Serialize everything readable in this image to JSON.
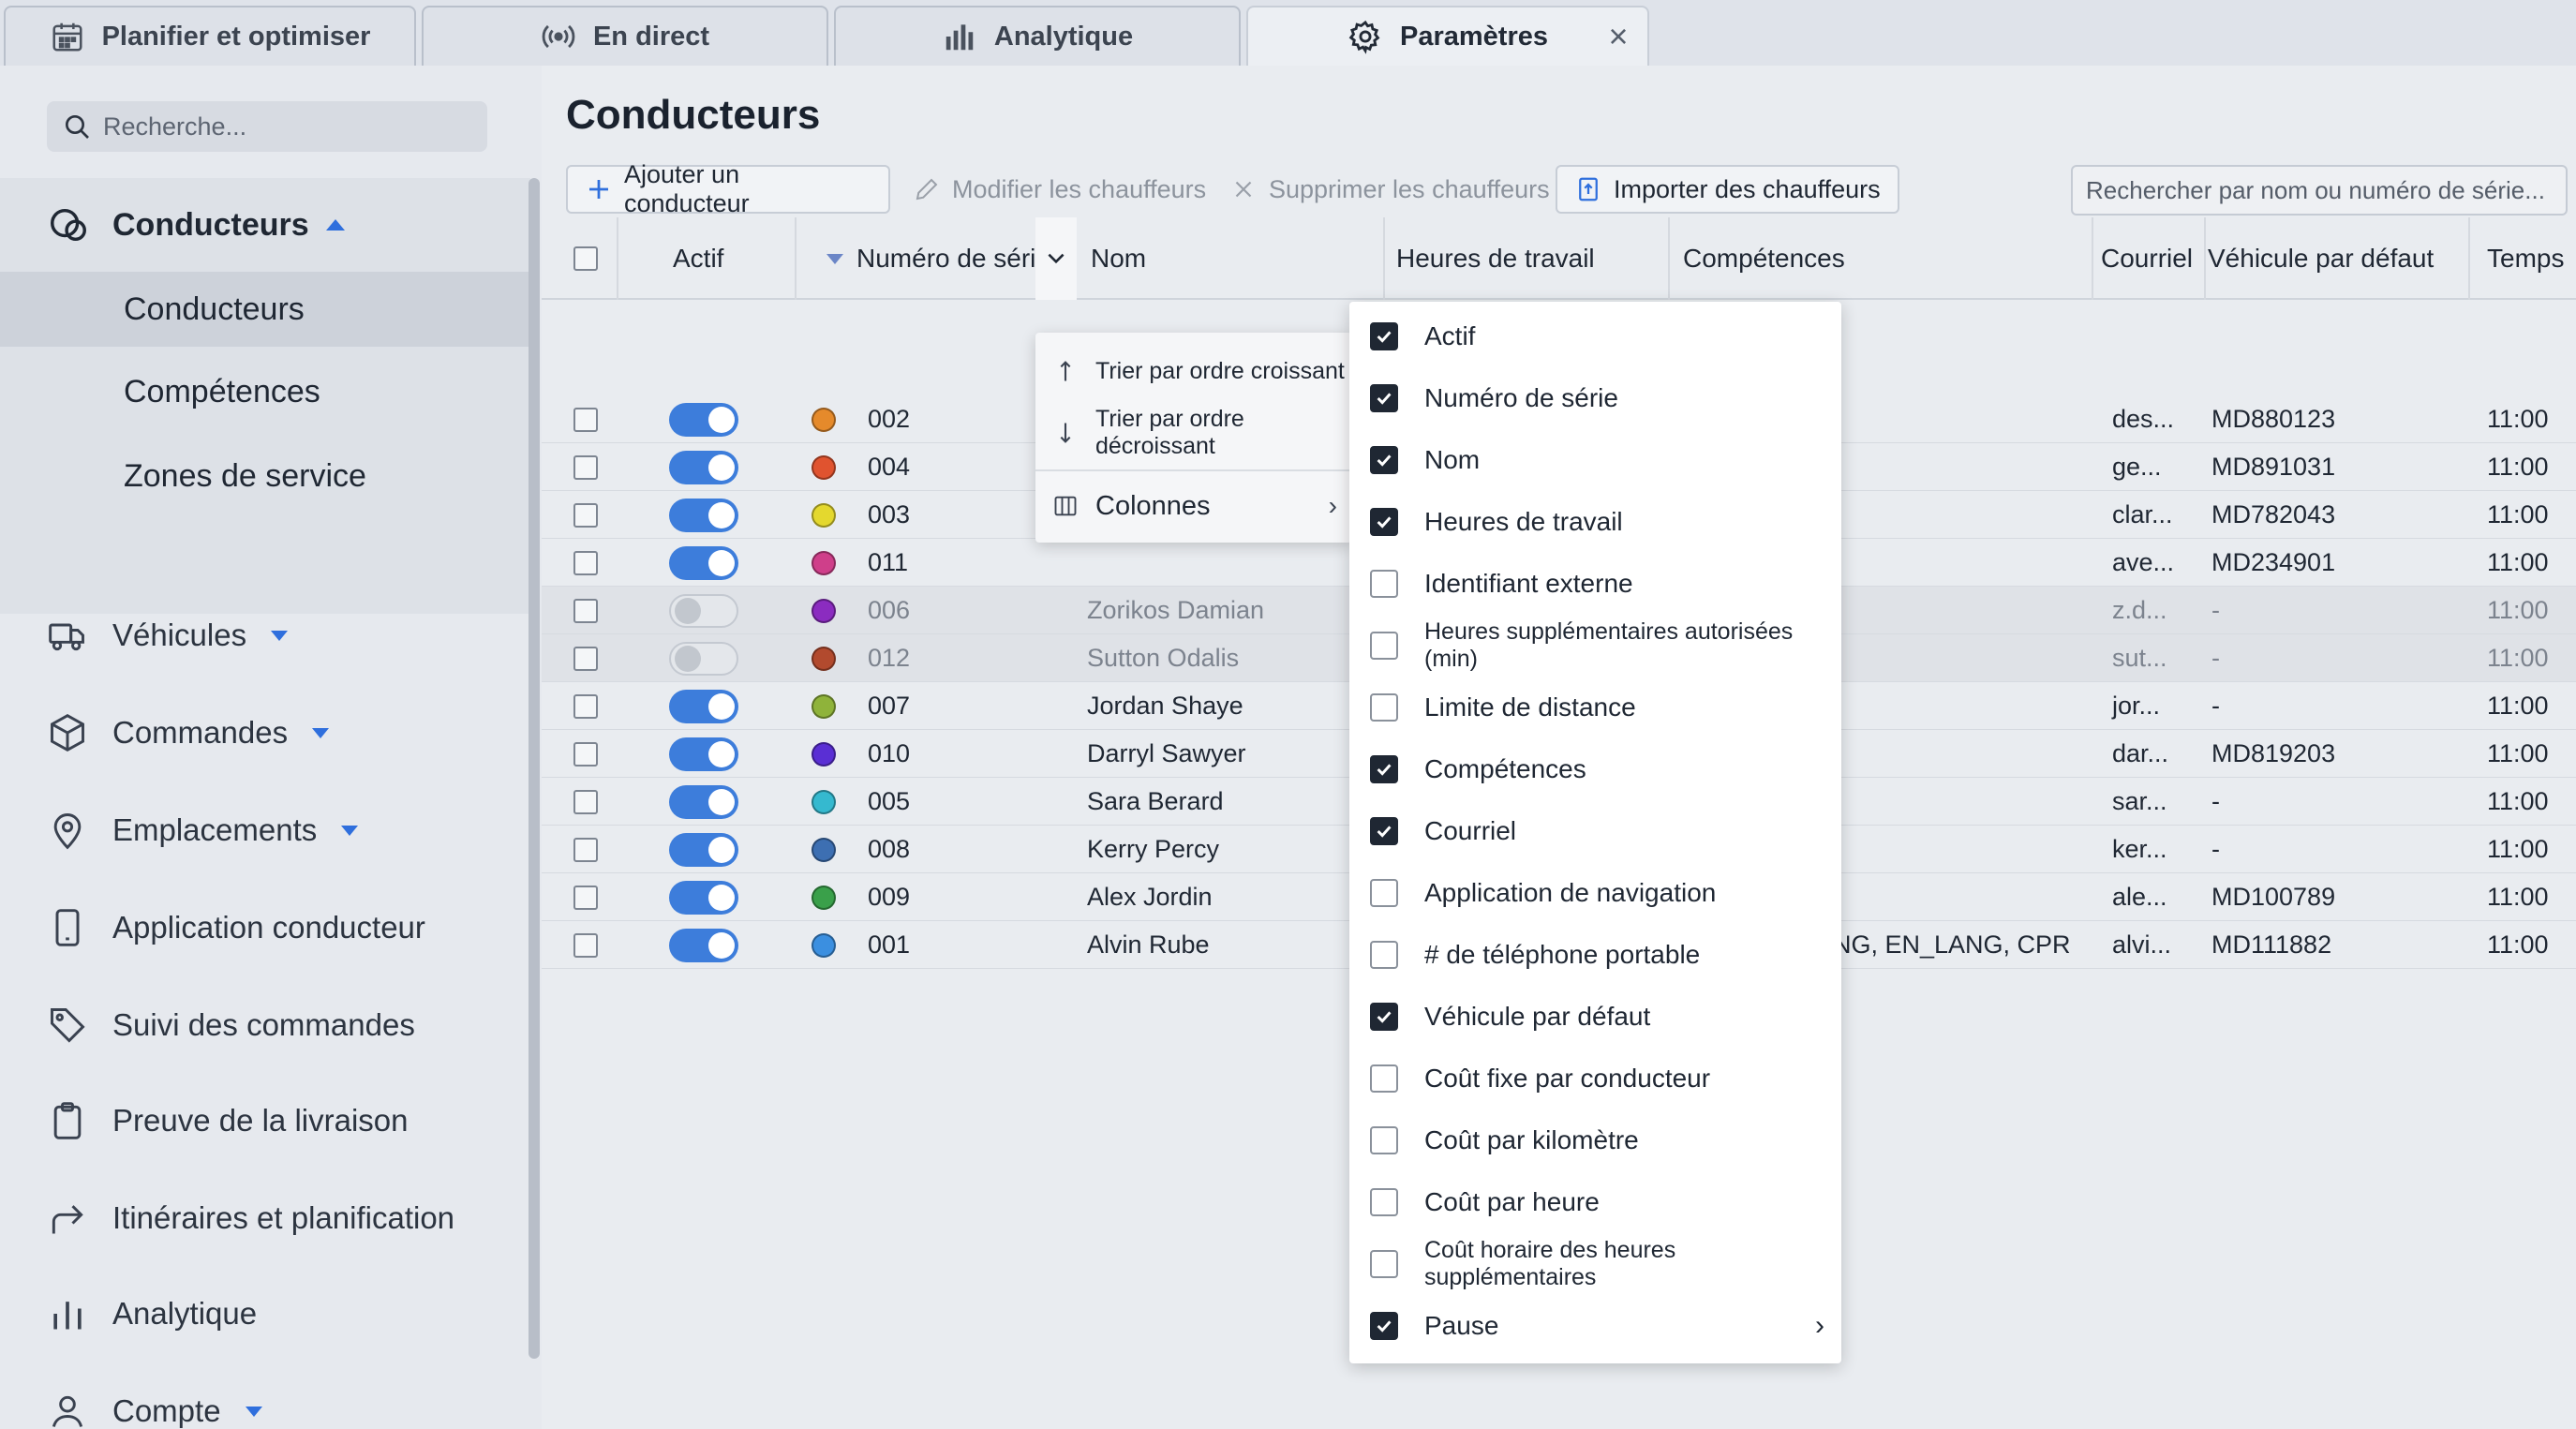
{
  "tabs": [
    {
      "label": "Planifier et optimiser",
      "icon": "calendar-icon"
    },
    {
      "label": "En direct",
      "icon": "broadcast-icon"
    },
    {
      "label": "Analytique",
      "icon": "bar-chart-icon"
    },
    {
      "label": "Paramètres",
      "icon": "gear-icon",
      "active": true
    }
  ],
  "sidebar": {
    "search_placeholder": "Recherche...",
    "group_label": "Conducteurs",
    "sub_items": [
      "Conducteurs",
      "Compétences",
      "Zones de service"
    ],
    "items": [
      {
        "label": "Véhicules",
        "icon": "truck-icon",
        "expandable": true
      },
      {
        "label": "Commandes",
        "icon": "package-icon",
        "expandable": true
      },
      {
        "label": "Emplacements",
        "icon": "location-pin-icon",
        "expandable": true
      },
      {
        "label": "Application conducteur",
        "icon": "phone-icon",
        "expandable": false
      },
      {
        "label": "Suivi des commandes",
        "icon": "tag-icon",
        "expandable": false
      },
      {
        "label": "Preuve de la livraison",
        "icon": "clipboard-icon",
        "expandable": false
      },
      {
        "label": "Itinéraires et planification",
        "icon": "route-arrow-icon",
        "expandable": false
      },
      {
        "label": "Analytique",
        "icon": "bar-chart-icon",
        "expandable": false
      },
      {
        "label": "Compte",
        "icon": "user-icon",
        "expandable": true
      }
    ]
  },
  "main": {
    "title": "Conducteurs",
    "toolbar": {
      "add": "Ajouter un conducteur",
      "edit": "Modifier les chauffeurs",
      "delete": "Supprimer les chauffeurs",
      "import": "Importer des chauffeurs"
    },
    "search_placeholder": "Rechercher par nom ou numéro de série...",
    "columns": {
      "active": "Actif",
      "serial": "Numéro de série",
      "name": "Nom",
      "hours": "Heures de travail",
      "skills": "Compétences",
      "email": "Courriel",
      "vehicle": "Véhicule par défaut",
      "time": "Temps"
    },
    "rows": [
      {
        "active": true,
        "color": "#e58a2b",
        "serial": "002",
        "name": "",
        "skills": "",
        "email": "des...",
        "vehicle": "MD880123",
        "time": "11:00"
      },
      {
        "active": true,
        "color": "#e0532f",
        "serial": "004",
        "name": "",
        "skills": "",
        "email": "ge...",
        "vehicle": "MD891031",
        "time": "11:00"
      },
      {
        "active": true,
        "color": "#e4d82e",
        "serial": "003",
        "name": "",
        "skills": "",
        "email": "clar...",
        "vehicle": "MD782043",
        "time": "11:00"
      },
      {
        "active": true,
        "color": "#cf3f8a",
        "serial": "011",
        "name": "",
        "skills": "",
        "email": "ave...",
        "vehicle": "MD234901",
        "time": "11:00"
      },
      {
        "active": false,
        "color": "#8b2cc0",
        "serial": "006",
        "name": "Zorikos Damian",
        "skills": "",
        "email": "z.d...",
        "vehicle": "-",
        "time": "11:00"
      },
      {
        "active": false,
        "color": "#b24a2e",
        "serial": "012",
        "name": "Sutton Odalis",
        "skills": "",
        "email": "sut...",
        "vehicle": "-",
        "time": "11:00"
      },
      {
        "active": true,
        "color": "#8fb33a",
        "serial": "007",
        "name": "Jordan Shaye",
        "skills": "",
        "email": "jor...",
        "vehicle": "-",
        "time": "11:00"
      },
      {
        "active": true,
        "color": "#5a2fd4",
        "serial": "010",
        "name": "Darryl Sawyer",
        "skills": "",
        "email": "dar...",
        "vehicle": "MD819203",
        "time": "11:00"
      },
      {
        "active": true,
        "color": "#35b9cf",
        "serial": "005",
        "name": "Sara Berard",
        "skills": "",
        "email": "sar...",
        "vehicle": "-",
        "time": "11:00"
      },
      {
        "active": true,
        "color": "#3d6fb2",
        "serial": "008",
        "name": "Kerry Percy",
        "skills": "",
        "email": "ker...",
        "vehicle": "-",
        "time": "11:00"
      },
      {
        "active": true,
        "color": "#3aa04a",
        "serial": "009",
        "name": "Alex Jordin",
        "skills": "",
        "email": "ale...",
        "vehicle": "MD100789",
        "time": "11:00"
      },
      {
        "active": true,
        "color": "#3b8fe0",
        "serial": "001",
        "name": "Alvin Rube",
        "skills": "NG, EN_LANG, CPR",
        "email": "alvi...",
        "vehicle": "MD111882",
        "time": "11:00"
      }
    ]
  },
  "context_menu": {
    "sort_asc": "Trier par ordre croissant",
    "sort_desc": "Trier par ordre décroissant",
    "columns": "Colonnes"
  },
  "column_chooser": [
    {
      "label": "Actif",
      "checked": true
    },
    {
      "label": "Numéro de série",
      "checked": true
    },
    {
      "label": "Nom",
      "checked": true
    },
    {
      "label": "Heures de travail",
      "checked": true
    },
    {
      "label": "Identifiant externe",
      "checked": false
    },
    {
      "label": "Heures supplémentaires autorisées (min)",
      "checked": false,
      "small": true
    },
    {
      "label": "Limite de distance",
      "checked": false
    },
    {
      "label": "Compétences",
      "checked": true
    },
    {
      "label": "Courriel",
      "checked": true
    },
    {
      "label": "Application de navigation",
      "checked": false
    },
    {
      "label": "# de téléphone portable",
      "checked": false
    },
    {
      "label": "Véhicule par défaut",
      "checked": true
    },
    {
      "label": "Coût fixe par conducteur",
      "checked": false
    },
    {
      "label": "Coût par kilomètre",
      "checked": false
    },
    {
      "label": "Coût par heure",
      "checked": false
    },
    {
      "label": "Coût horaire des heures supplémentaires",
      "checked": false,
      "small": true
    },
    {
      "label": "Pause",
      "checked": true,
      "submenu": true
    }
  ],
  "colors": {
    "accent": "#3d7ddb",
    "caret": "#2f6fdd"
  }
}
